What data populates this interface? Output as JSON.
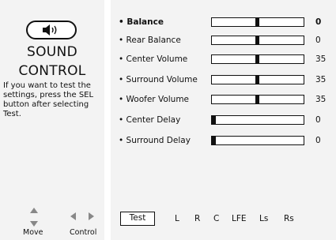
{
  "sidebar": {
    "title_line1": "SOUND",
    "title_line2": "CONTROL",
    "help_text": "If you want to test the settings, press the SEL button after selecting Test.",
    "nav_move_label": "Move",
    "nav_control_label": "Control",
    "speaker_icon": "speaker-icon"
  },
  "settings": [
    {
      "label": "• Balance",
      "value": "0",
      "selected": true,
      "level": 0.5
    },
    {
      "label": "• Rear Balance",
      "value": "0",
      "selected": false,
      "level": 0.5
    },
    {
      "label": "• Center Volume",
      "value": "35",
      "selected": false,
      "level": 0.5
    },
    {
      "label": "• Surround Volume",
      "value": "35",
      "selected": false,
      "level": 0.5
    },
    {
      "label": "• Woofer Volume",
      "value": "35",
      "selected": false,
      "level": 0.5
    },
    {
      "label": "• Center Delay",
      "value": "0",
      "selected": false,
      "level": 0.0
    },
    {
      "label": "• Surround Delay",
      "value": "0",
      "selected": false,
      "level": 0.0
    }
  ],
  "test": {
    "button_label": "Test",
    "channels": [
      "L",
      "R",
      "C",
      "LFE",
      "Ls",
      "Rs"
    ]
  }
}
